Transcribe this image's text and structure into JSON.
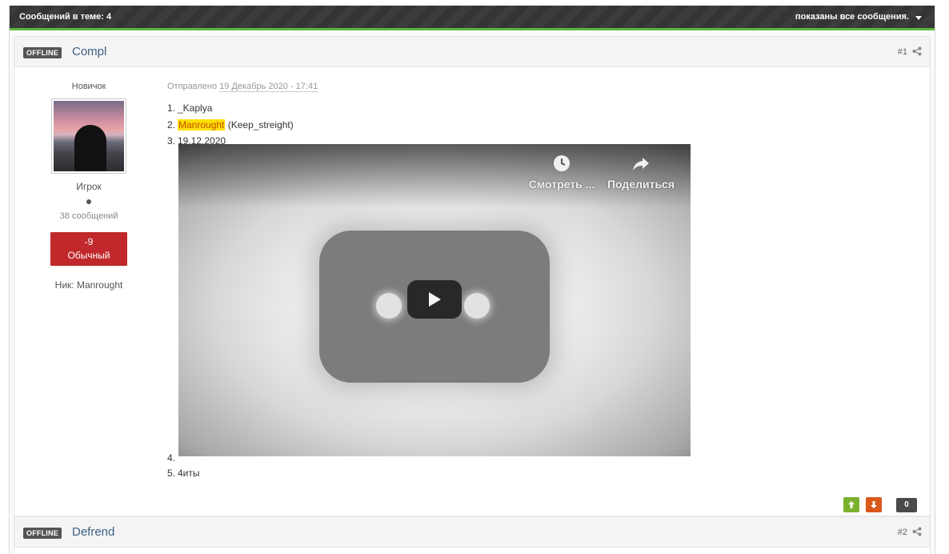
{
  "topbar": {
    "message_count": "Сообщений в теме: 4",
    "shown_label": "показаны все сообщения."
  },
  "posts": [
    {
      "status": "OFFLINE",
      "author": "Compl",
      "number": "#1",
      "rank_title": "Новичок",
      "group": "Игрок",
      "messages": "38 сообщений",
      "reputation_value": "-9",
      "reputation_label": "Обычный",
      "nick": "Ник: Manrought",
      "posted_prefix": "Отправлено",
      "posted_date": "19 Декабрь 2020 - 17:41",
      "lines": [
        {
          "n": "1.",
          "text": "_Kaplya"
        },
        {
          "n": "2.",
          "highlight": "Manrought",
          "text": "(Keep_streight)"
        },
        {
          "n": "3.",
          "text": "19.12.2020"
        },
        {
          "n": "4.",
          "text": ""
        },
        {
          "n": "5.",
          "text": "4иты"
        }
      ],
      "video": {
        "watch_label": "Смотреть ...",
        "share_label": "Поделиться"
      },
      "score": "0"
    },
    {
      "status": "OFFLINE",
      "author": "Defrend",
      "number": "#2"
    }
  ],
  "colors": {
    "accent_green": "#58b83c",
    "reputation_bg": "#c0282b",
    "highlight": "#ffe000",
    "author_link": "#3b5f82"
  }
}
